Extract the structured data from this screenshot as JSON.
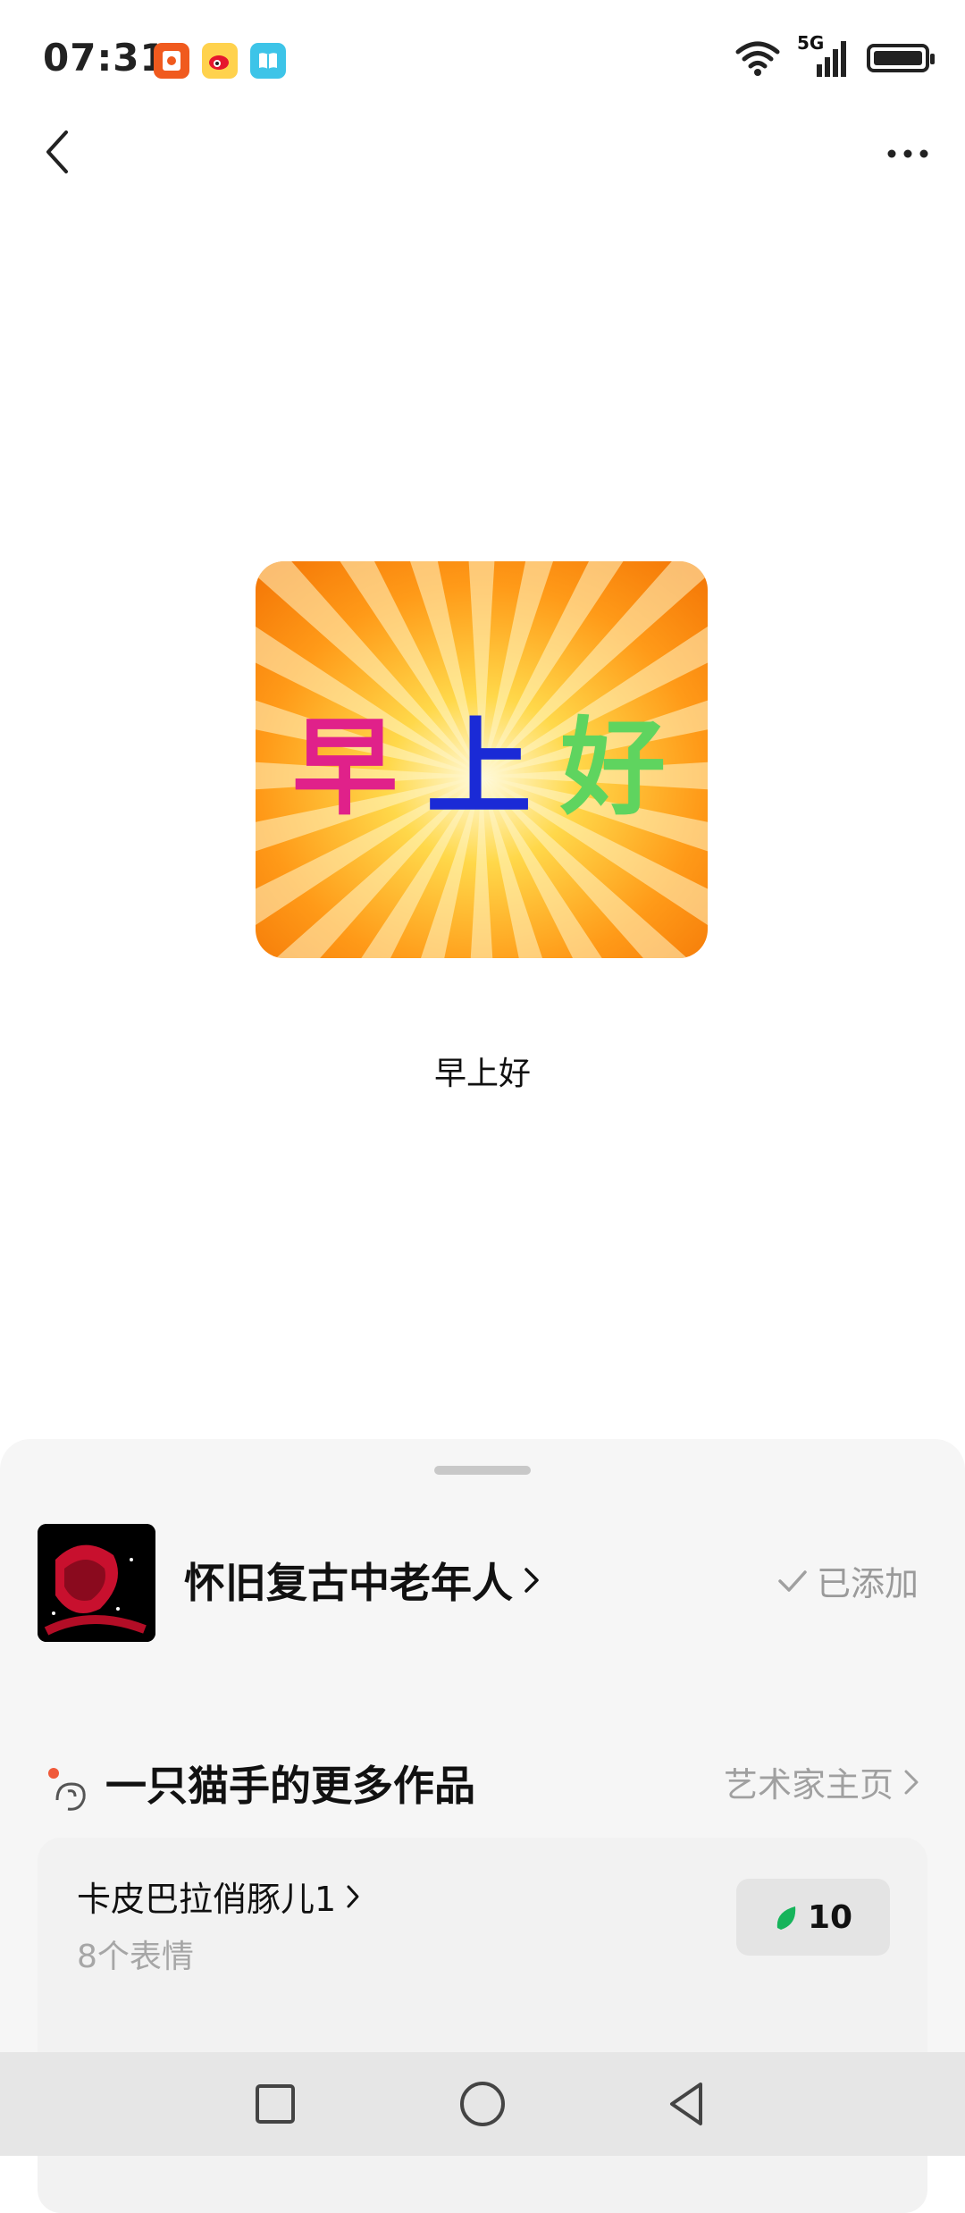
{
  "status_bar": {
    "time": "07:31",
    "app_icons": [
      "red-envelope-app-icon",
      "weibo-app-icon",
      "book-app-icon"
    ],
    "network": "5G"
  },
  "header": {
    "back": "back-icon",
    "more": "more-icon"
  },
  "sticker": {
    "text_chars": [
      "早",
      "上",
      "好"
    ],
    "char_colors": [
      "#e0218a",
      "#1a2ad6",
      "#5fd45f"
    ],
    "caption": "早上好"
  },
  "pack": {
    "name": "怀旧复古中老年人",
    "status": "已添加"
  },
  "artist_section": {
    "title": "一只猫手的更多作品",
    "link": "艺术家主页"
  },
  "featured_pack": {
    "title": "卡皮巴拉俏豚儿1",
    "count": "8个表情",
    "price": "10",
    "accent": "#16b45b"
  },
  "colors": {
    "background": "#ffffff",
    "sheet": "#f6f6f6",
    "muted_text": "#9a9a9a"
  }
}
